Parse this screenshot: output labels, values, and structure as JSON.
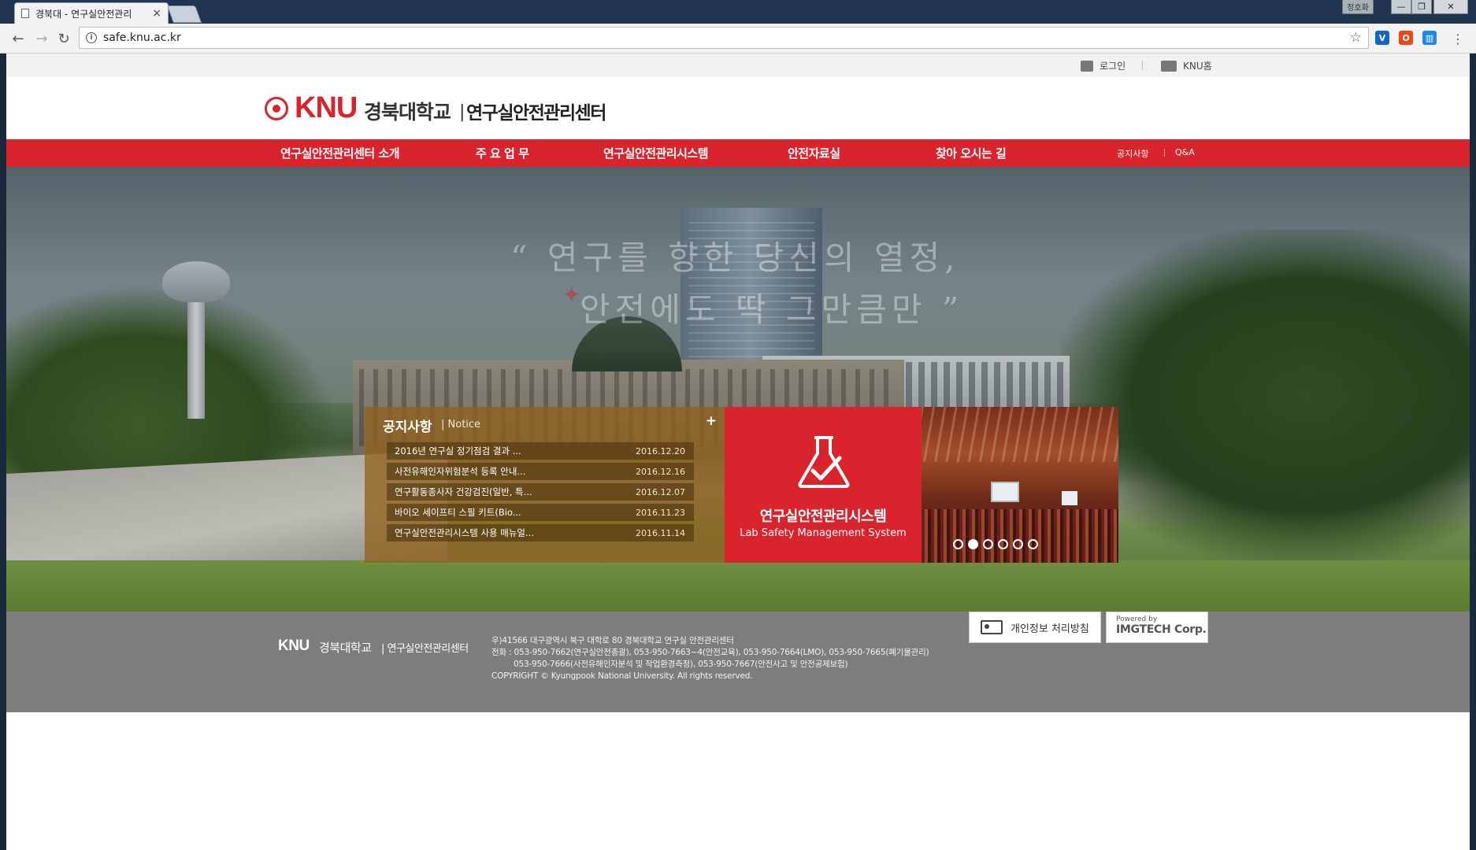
{
  "browser": {
    "tab_title": "경북대 - 연구실안전관리",
    "tab_close": "×",
    "profile": "정호화",
    "win_minimize": "—",
    "win_maximize": "❐",
    "win_close": "✕",
    "url": "safe.knu.ac.kr",
    "back_icon": "←",
    "forward_icon": "→",
    "reload_icon": "↻",
    "star_icon": "☆",
    "menu_icon": "⋮"
  },
  "util": {
    "login": "로그인",
    "knu_home": "KNU홈"
  },
  "logo": {
    "knu": "KNU",
    "university": "경북대학교",
    "bar": "|",
    "center": "연구실안전관리센터"
  },
  "gnb": {
    "items": [
      "연구실안전관리센터 소개",
      "주 요 업 무",
      "연구실안전관리시스템",
      "안전자료실",
      "찾아 오시는 길"
    ],
    "sub": [
      "공지사항",
      "Q&A"
    ]
  },
  "hero": {
    "quote_line1": "“ 연구를 향한 당신의 열정,",
    "quote_line2": "안전에도 딱 그만큼만 ”"
  },
  "notice": {
    "title": "공지사항",
    "subtitle": "| Notice",
    "more": "+",
    "rows": [
      {
        "title": "2016년 연구실 정기점검 결과 ...",
        "date": "2016.12.20"
      },
      {
        "title": "사전유해인자위험분석 등록 안내...",
        "date": "2016.12.16"
      },
      {
        "title": "연구활동종사자 건강검진(일반, 특...",
        "date": "2016.12.07"
      },
      {
        "title": "바이오 세이프티 스필 키트(Bio...",
        "date": "2016.11.23"
      },
      {
        "title": "연구실안전관리시스템 사용 매뉴얼...",
        "date": "2016.11.14"
      }
    ]
  },
  "lms": {
    "title": "연구실안전관리시스템",
    "subtitle": "Lab Safety Management System"
  },
  "slide": {
    "dots": 6,
    "active_dot": 2
  },
  "footer": {
    "logo_knu": "KNU",
    "logo_univ": "경북대학교",
    "logo_center": "| 연구실안전관리센터",
    "address": "우)41566 대구광역시 북구 대학로 80 경북대학교 연구실 안전관리센터",
    "phone1": "전화 : 053-950-7662(연구실안전총괄), 053-950-7663~4(안전교육), 053-950-7664(LMO), 053-950-7665(폐기물관리)",
    "phone2": "053-950-7666(사전유해인자분석 및 작업환경측정), 053-950-7667(안전사고 및 안전공제보험)",
    "copyright": "COPYRIGHT © Kyungpook National University. All rights reserved.",
    "privacy": "개인정보 처리방침",
    "powered_by": "Powered by",
    "powered_name": "IMGTECH Corp."
  },
  "colors": {
    "brand_red": "#d9232d",
    "notice_bg": "#91621e",
    "footer_bg": "#7d7d7d"
  }
}
